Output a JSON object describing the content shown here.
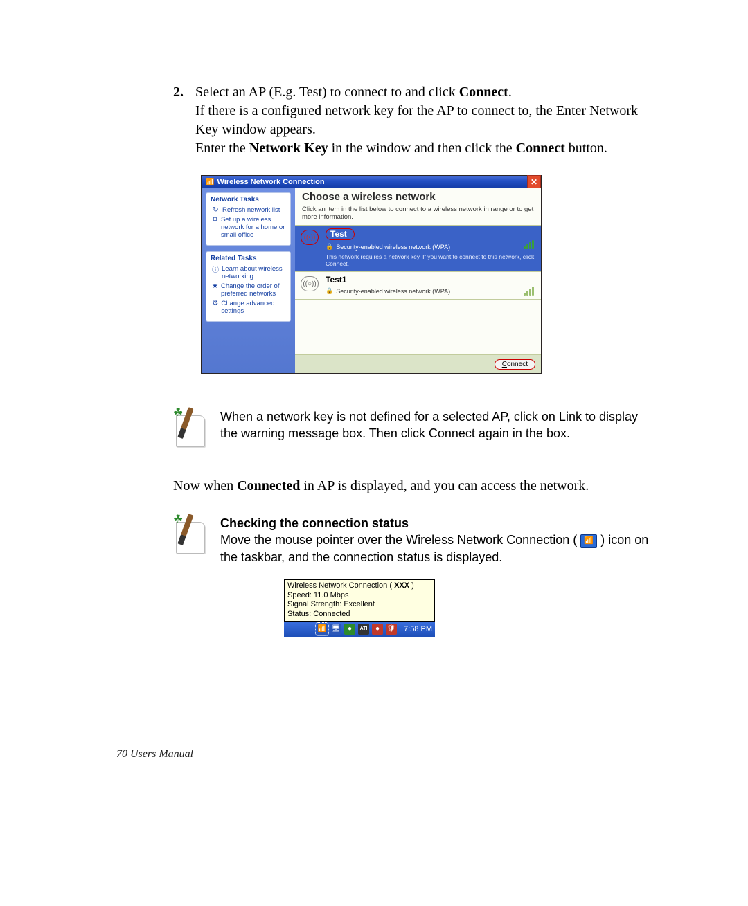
{
  "step": {
    "number": "2.",
    "line1a": "Select an AP (E.g. Test) to connect to and click ",
    "line1b": "Connect",
    "line1c": ".",
    "line2": "If there is a configured network key for the AP to connect to, the Enter Network Key window appears.",
    "line3a": "Enter the ",
    "line3b": "Network Key",
    "line3c": " in the window and then click the ",
    "line3d": "Connect",
    "line3e": " button."
  },
  "wnc": {
    "title": "Wireless Network Connection",
    "side": {
      "g1title": "Network Tasks",
      "g1i1": "Refresh network list",
      "g1i2": "Set up a wireless network for a home or small office",
      "g2title": "Related Tasks",
      "g2i1": "Learn about wireless networking",
      "g2i2": "Change the order of preferred networks",
      "g2i3": "Change advanced settings"
    },
    "main": {
      "heading": "Choose a wireless network",
      "sub": "Click an item in the list below to connect to a wireless network in range or to get more information.",
      "n1name": "Test",
      "n1sec": "Security-enabled wireless network (WPA)",
      "n1hint": "This network requires a network key. If you want to connect to this network, click Connect.",
      "n2name": "Test1",
      "n2sec": "Security-enabled wireless network (WPA)",
      "connect": "Connect"
    }
  },
  "note1": "When a network key is not defined for a selected AP, click on Link to display the warning message box. Then click Connect again in the box.",
  "mid": {
    "a": "Now when ",
    "b": "Connected",
    "c": " in AP is displayed, and you can access the network."
  },
  "check": {
    "title": "Checking the connection status",
    "t1": "Move the mouse pointer over the Wireless Network Connection (",
    "t2": ") icon on the taskbar, and the connection status is displayed."
  },
  "tooltip": {
    "l1a": "Wireless Network Connection ( ",
    "l1b": "XXX",
    "l1c": " )",
    "l2": "Speed: 11.0 Mbps",
    "l3": "Signal Strength: Excellent",
    "l4a": "Status: ",
    "l4b": "Connected",
    "clock": "7:58 PM"
  },
  "footer": "70  Users Manual"
}
